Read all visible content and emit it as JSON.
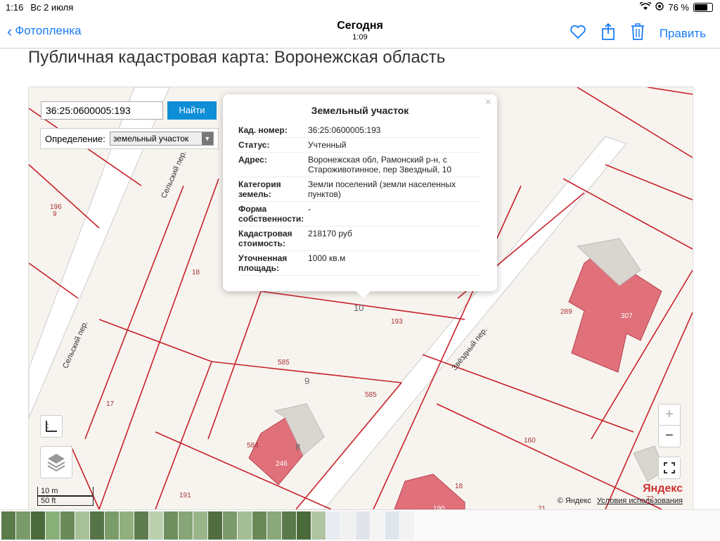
{
  "status_bar": {
    "time": "1:16",
    "date": "Вс 2 июля",
    "battery": "76 %",
    "battery_fraction": 0.76
  },
  "nav": {
    "back_label": "Фотопленка",
    "title": "Сегодня",
    "subtitle": "1:09",
    "edit_label": "Править"
  },
  "page": {
    "heading": "Публичная кадастровая карта: Воронежская область"
  },
  "search": {
    "value": "36:25:0600005:193",
    "button_label": "Найти",
    "definition_label": "Определение:",
    "definition_value": "земельный участок"
  },
  "popup": {
    "title": "Земельный участок",
    "close": "×",
    "rows": [
      {
        "key": "Кад. номер:",
        "value": "36:25:0600005:193"
      },
      {
        "key": "Статус:",
        "value": "Учтенный"
      },
      {
        "key": "Адрес:",
        "value": "Воронежская обл, Рамонский р-н, с Староживотинное, пер Звездный, 10"
      },
      {
        "key": "Категория земель:",
        "value": "Земли поселений (земли населенных пунктов)"
      },
      {
        "key": "Форма собственности:",
        "value": "-"
      },
      {
        "key": "Кадастровая стоимость:",
        "value": "218170 руб"
      },
      {
        "key": "Уточненная площадь:",
        "value": "1000 кв.м"
      }
    ]
  },
  "map": {
    "street_labels": [
      "Сельский пер.",
      "Сельский пер.",
      "Звёздный пер."
    ],
    "parcel_labels": [
      "196",
      "9",
      "18",
      "193",
      "10",
      "585",
      "9",
      "585",
      "17",
      "584",
      "246",
      "8",
      "160",
      "289",
      "307",
      "191",
      "18",
      "190",
      "21",
      "72"
    ],
    "zoom_in": "+",
    "zoom_out": "−",
    "scale_m": "10 m",
    "scale_ft": "50 ft",
    "copyright": "© Яндекс",
    "terms": "Условия использования",
    "logo": "Яндекс"
  },
  "filmstrip": {
    "thumb_colors": [
      "#5a7b4a",
      "#7a9a6a",
      "#4c6a3c",
      "#8ab07a",
      "#6a8a5a",
      "#a8c098",
      "#567448",
      "#7b9c68",
      "#92b07e",
      "#5e7c4e",
      "#bcd0b0",
      "#6f8f5e",
      "#87a576",
      "#9ab58a",
      "#506e40",
      "#7c9a6c",
      "#a4bd94",
      "#6a8858",
      "#8aa87a",
      "#5b7a4b",
      "#4a6a3a",
      "#b0c4a4",
      "#e8ecf0",
      "#f0f0f0",
      "#e0e4ea",
      "#f4f4f4",
      "#dfe6ee",
      "#f2f2f2"
    ]
  },
  "colors": {
    "accent": "#1a7cf5",
    "parcel_line": "#c8202a",
    "building": "#e0707a",
    "search_button": "#0e8ed7"
  }
}
